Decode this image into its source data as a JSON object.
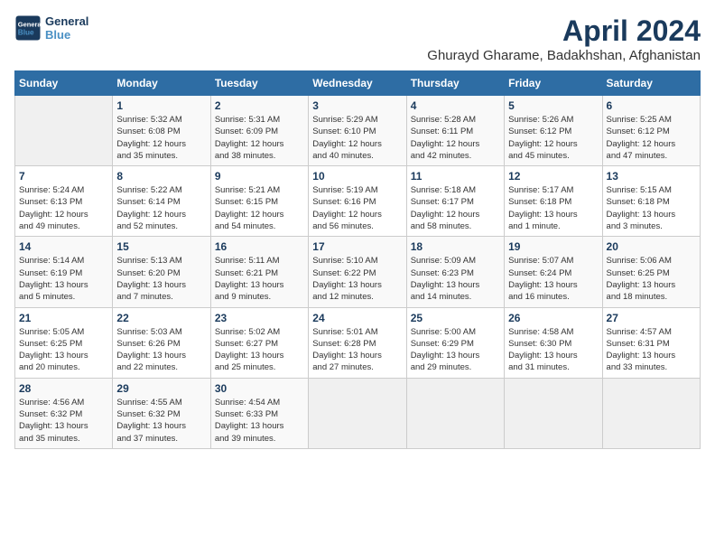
{
  "logo": {
    "line1": "General",
    "line2": "Blue"
  },
  "title": "April 2024",
  "subtitle": "Ghurayd Gharame, Badakhshan, Afghanistan",
  "headers": [
    "Sunday",
    "Monday",
    "Tuesday",
    "Wednesday",
    "Thursday",
    "Friday",
    "Saturday"
  ],
  "weeks": [
    [
      {
        "date": "",
        "info": ""
      },
      {
        "date": "1",
        "info": "Sunrise: 5:32 AM\nSunset: 6:08 PM\nDaylight: 12 hours\nand 35 minutes."
      },
      {
        "date": "2",
        "info": "Sunrise: 5:31 AM\nSunset: 6:09 PM\nDaylight: 12 hours\nand 38 minutes."
      },
      {
        "date": "3",
        "info": "Sunrise: 5:29 AM\nSunset: 6:10 PM\nDaylight: 12 hours\nand 40 minutes."
      },
      {
        "date": "4",
        "info": "Sunrise: 5:28 AM\nSunset: 6:11 PM\nDaylight: 12 hours\nand 42 minutes."
      },
      {
        "date": "5",
        "info": "Sunrise: 5:26 AM\nSunset: 6:12 PM\nDaylight: 12 hours\nand 45 minutes."
      },
      {
        "date": "6",
        "info": "Sunrise: 5:25 AM\nSunset: 6:12 PM\nDaylight: 12 hours\nand 47 minutes."
      }
    ],
    [
      {
        "date": "7",
        "info": "Sunrise: 5:24 AM\nSunset: 6:13 PM\nDaylight: 12 hours\nand 49 minutes."
      },
      {
        "date": "8",
        "info": "Sunrise: 5:22 AM\nSunset: 6:14 PM\nDaylight: 12 hours\nand 52 minutes."
      },
      {
        "date": "9",
        "info": "Sunrise: 5:21 AM\nSunset: 6:15 PM\nDaylight: 12 hours\nand 54 minutes."
      },
      {
        "date": "10",
        "info": "Sunrise: 5:19 AM\nSunset: 6:16 PM\nDaylight: 12 hours\nand 56 minutes."
      },
      {
        "date": "11",
        "info": "Sunrise: 5:18 AM\nSunset: 6:17 PM\nDaylight: 12 hours\nand 58 minutes."
      },
      {
        "date": "12",
        "info": "Sunrise: 5:17 AM\nSunset: 6:18 PM\nDaylight: 13 hours\nand 1 minute."
      },
      {
        "date": "13",
        "info": "Sunrise: 5:15 AM\nSunset: 6:18 PM\nDaylight: 13 hours\nand 3 minutes."
      }
    ],
    [
      {
        "date": "14",
        "info": "Sunrise: 5:14 AM\nSunset: 6:19 PM\nDaylight: 13 hours\nand 5 minutes."
      },
      {
        "date": "15",
        "info": "Sunrise: 5:13 AM\nSunset: 6:20 PM\nDaylight: 13 hours\nand 7 minutes."
      },
      {
        "date": "16",
        "info": "Sunrise: 5:11 AM\nSunset: 6:21 PM\nDaylight: 13 hours\nand 9 minutes."
      },
      {
        "date": "17",
        "info": "Sunrise: 5:10 AM\nSunset: 6:22 PM\nDaylight: 13 hours\nand 12 minutes."
      },
      {
        "date": "18",
        "info": "Sunrise: 5:09 AM\nSunset: 6:23 PM\nDaylight: 13 hours\nand 14 minutes."
      },
      {
        "date": "19",
        "info": "Sunrise: 5:07 AM\nSunset: 6:24 PM\nDaylight: 13 hours\nand 16 minutes."
      },
      {
        "date": "20",
        "info": "Sunrise: 5:06 AM\nSunset: 6:25 PM\nDaylight: 13 hours\nand 18 minutes."
      }
    ],
    [
      {
        "date": "21",
        "info": "Sunrise: 5:05 AM\nSunset: 6:25 PM\nDaylight: 13 hours\nand 20 minutes."
      },
      {
        "date": "22",
        "info": "Sunrise: 5:03 AM\nSunset: 6:26 PM\nDaylight: 13 hours\nand 22 minutes."
      },
      {
        "date": "23",
        "info": "Sunrise: 5:02 AM\nSunset: 6:27 PM\nDaylight: 13 hours\nand 25 minutes."
      },
      {
        "date": "24",
        "info": "Sunrise: 5:01 AM\nSunset: 6:28 PM\nDaylight: 13 hours\nand 27 minutes."
      },
      {
        "date": "25",
        "info": "Sunrise: 5:00 AM\nSunset: 6:29 PM\nDaylight: 13 hours\nand 29 minutes."
      },
      {
        "date": "26",
        "info": "Sunrise: 4:58 AM\nSunset: 6:30 PM\nDaylight: 13 hours\nand 31 minutes."
      },
      {
        "date": "27",
        "info": "Sunrise: 4:57 AM\nSunset: 6:31 PM\nDaylight: 13 hours\nand 33 minutes."
      }
    ],
    [
      {
        "date": "28",
        "info": "Sunrise: 4:56 AM\nSunset: 6:32 PM\nDaylight: 13 hours\nand 35 minutes."
      },
      {
        "date": "29",
        "info": "Sunrise: 4:55 AM\nSunset: 6:32 PM\nDaylight: 13 hours\nand 37 minutes."
      },
      {
        "date": "30",
        "info": "Sunrise: 4:54 AM\nSunset: 6:33 PM\nDaylight: 13 hours\nand 39 minutes."
      },
      {
        "date": "",
        "info": ""
      },
      {
        "date": "",
        "info": ""
      },
      {
        "date": "",
        "info": ""
      },
      {
        "date": "",
        "info": ""
      }
    ]
  ]
}
